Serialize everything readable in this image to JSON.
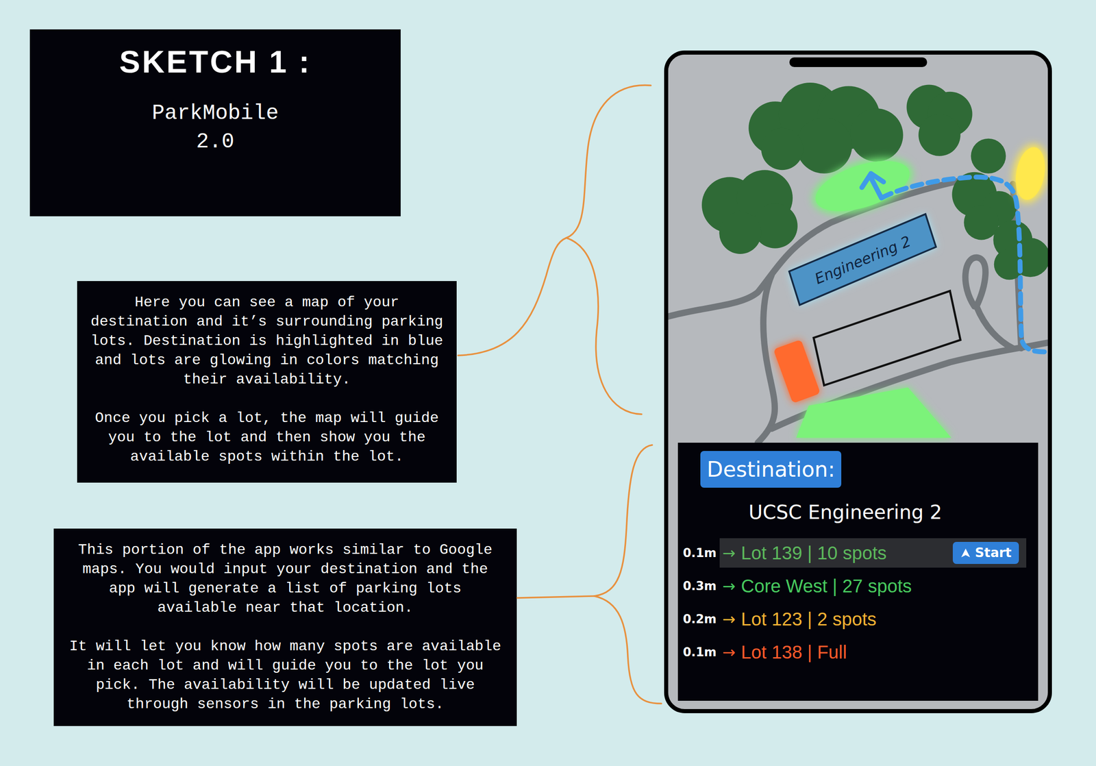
{
  "title": {
    "heading": "SKETCH 1 :",
    "app_name": "ParkMobile",
    "version": "2.0"
  },
  "notes": [
    {
      "paragraphs": [
        [
          "Here you can see a map of your",
          "destination and it’s surrounding parking",
          "lots. Destination is highlighted in blue",
          "and lots are glowing in colors matching",
          "their availability."
        ],
        [
          "Once you pick a lot, the map will guide",
          "you to the lot and then show you the",
          "available spots within the lot."
        ]
      ]
    },
    {
      "paragraphs": [
        [
          "This portion of the app works similar to Google",
          "maps. You would input your destination and the",
          "app will generate a list of parking lots",
          "available near that location."
        ],
        [
          "It will let you know how many spots are available",
          "in each lot and will guide you to the lot you",
          "pick. The availability will be updated live",
          "through sensors in the parking lots."
        ]
      ]
    }
  ],
  "map": {
    "destination_label": "Engineering 2",
    "lots": [
      {
        "color": "#7cf27a"
      },
      {
        "color": "#7cf27a"
      },
      {
        "color": "#ff6a2e"
      },
      {
        "color": "#ffe84d"
      }
    ]
  },
  "panel": {
    "badge": "Destination:",
    "destination": "UCSC Engineering 2",
    "start_button": "Start",
    "lots": [
      {
        "distance": "0.1m",
        "arrow": "→",
        "label": "Lot 139 | 10 spots",
        "color": "#5cb85c",
        "selected": true
      },
      {
        "distance": "0.3m",
        "arrow": "→",
        "label": "Core West | 27 spots",
        "color": "#47c95e",
        "selected": false
      },
      {
        "distance": "0.2m",
        "arrow": "→",
        "label": "Lot 123 | 2 spots",
        "color": "#f2b233",
        "selected": false
      },
      {
        "distance": "0.1m",
        "arrow": "→",
        "label": "Lot 138 | Full",
        "color": "#ff5a2a",
        "selected": false
      }
    ]
  }
}
